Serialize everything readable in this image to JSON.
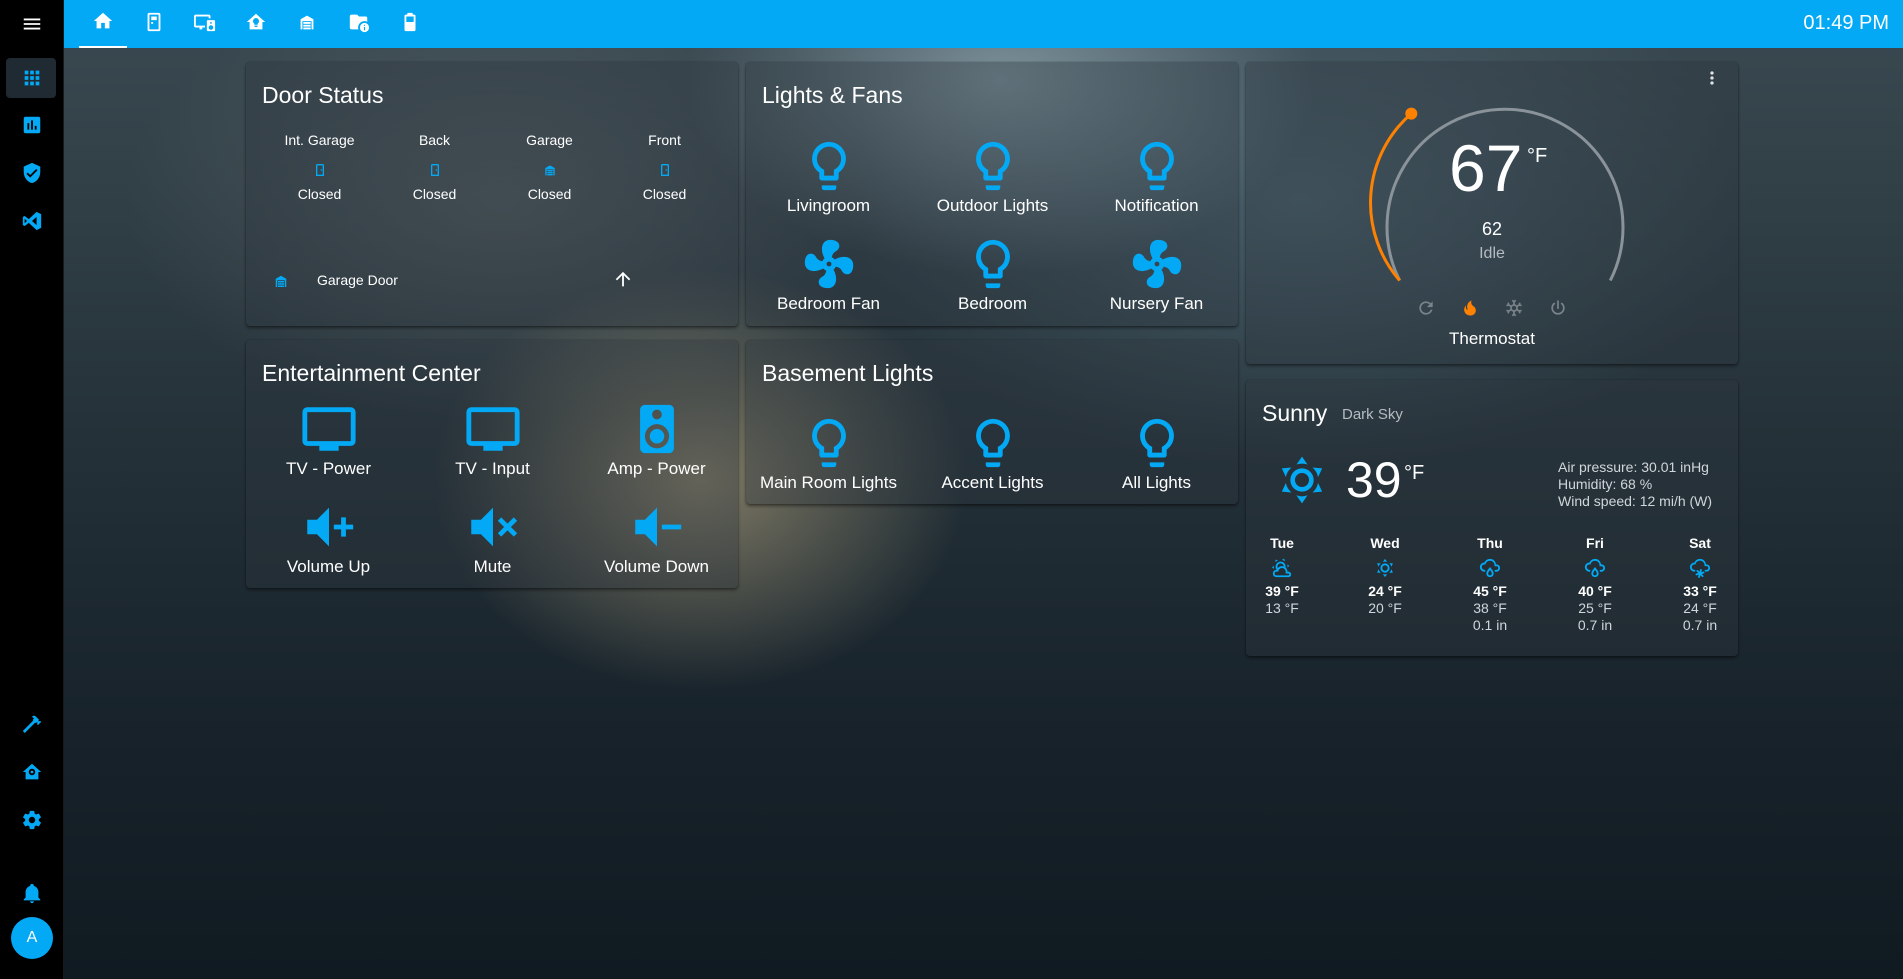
{
  "topbar": {
    "tabs": [
      {
        "icon": "home-icon",
        "active": true
      },
      {
        "icon": "door-panel-icon"
      },
      {
        "icon": "monitor-speaker-icon"
      },
      {
        "icon": "home-lightbulb-icon"
      },
      {
        "icon": "garage-icon"
      },
      {
        "icon": "folder-info-icon"
      },
      {
        "icon": "battery-icon"
      }
    ],
    "clock": "01:49 PM"
  },
  "sidebar": {
    "items": [
      "menu-icon",
      "dashboard-grid-icon",
      "chart-icon",
      "shield-check-icon",
      "vscode-icon",
      "hammer-icon",
      "home-gear-icon",
      "gear-icon",
      "bell-icon"
    ],
    "avatar_initial": "A"
  },
  "door_status": {
    "title": "Door Status",
    "doors": [
      {
        "name": "Int. Garage",
        "state": "Closed",
        "icon": "door-closed-icon"
      },
      {
        "name": "Back",
        "state": "Closed",
        "icon": "door-closed-icon"
      },
      {
        "name": "Garage",
        "state": "Closed",
        "icon": "garage-icon"
      },
      {
        "name": "Front",
        "state": "Closed",
        "icon": "door-closed-icon"
      }
    ],
    "garage_door_label": "Garage Door"
  },
  "lights_fans": {
    "title": "Lights & Fans",
    "items": [
      {
        "label": "Livingroom",
        "icon": "lightbulb-icon"
      },
      {
        "label": "Outdoor Lights",
        "icon": "lightbulb-icon"
      },
      {
        "label": "Notification",
        "icon": "lightbulb-icon"
      },
      {
        "label": "Bedroom Fan",
        "icon": "fan-icon"
      },
      {
        "label": "Bedroom",
        "icon": "lightbulb-icon"
      },
      {
        "label": "Nursery Fan",
        "icon": "fan-icon"
      }
    ]
  },
  "thermostat": {
    "current_temp": "67",
    "unit": "°F",
    "target_temp": "62",
    "action": "Idle",
    "name": "Thermostat",
    "modes": [
      "refresh-auto-icon",
      "flame-icon",
      "snowflake-icon",
      "power-icon"
    ],
    "active_mode": "flame-icon",
    "colors": {
      "heat": "#ff8100",
      "track": "#8a9399"
    }
  },
  "entertainment": {
    "title": "Entertainment Center",
    "items": [
      {
        "label": "TV - Power",
        "icon": "television-icon"
      },
      {
        "label": "TV - Input",
        "icon": "television-icon"
      },
      {
        "label": "Amp - Power",
        "icon": "speaker-icon"
      },
      {
        "label": "Volume Up",
        "icon": "volume-plus-icon"
      },
      {
        "label": "Mute",
        "icon": "volume-mute-icon"
      },
      {
        "label": "Volume Down",
        "icon": "volume-minus-icon"
      }
    ]
  },
  "basement": {
    "title": "Basement Lights",
    "items": [
      {
        "label": "Main Room Lights",
        "icon": "lightbulb-icon"
      },
      {
        "label": "Accent Lights",
        "icon": "lightbulb-icon"
      },
      {
        "label": "All Lights",
        "icon": "lightbulb-icon"
      }
    ]
  },
  "weather": {
    "condition": "Sunny",
    "source": "Dark Sky",
    "temp": "39",
    "unit": "°F",
    "pressure": "Air pressure: 30.01 inHg",
    "humidity": "Humidity: 68 %",
    "wind": "Wind speed: 12 mi/h (W)",
    "forecast": [
      {
        "day": "Tue",
        "hi": "39 °F",
        "lo": "13 °F",
        "precip": "",
        "icon": "partly-cloudy-icon"
      },
      {
        "day": "Wed",
        "hi": "24 °F",
        "lo": "20 °F",
        "precip": "",
        "icon": "sunny-icon"
      },
      {
        "day": "Thu",
        "hi": "45 °F",
        "lo": "38 °F",
        "precip": "0.1 in",
        "icon": "rainy-icon"
      },
      {
        "day": "Fri",
        "hi": "40 °F",
        "lo": "25 °F",
        "precip": "0.7 in",
        "icon": "rainy-icon"
      },
      {
        "day": "Sat",
        "hi": "33 °F",
        "lo": "24 °F",
        "precip": "0.7 in",
        "icon": "snowy-icon"
      }
    ]
  },
  "colors": {
    "accent": "#03a9f4",
    "sidebar": "#000000"
  }
}
